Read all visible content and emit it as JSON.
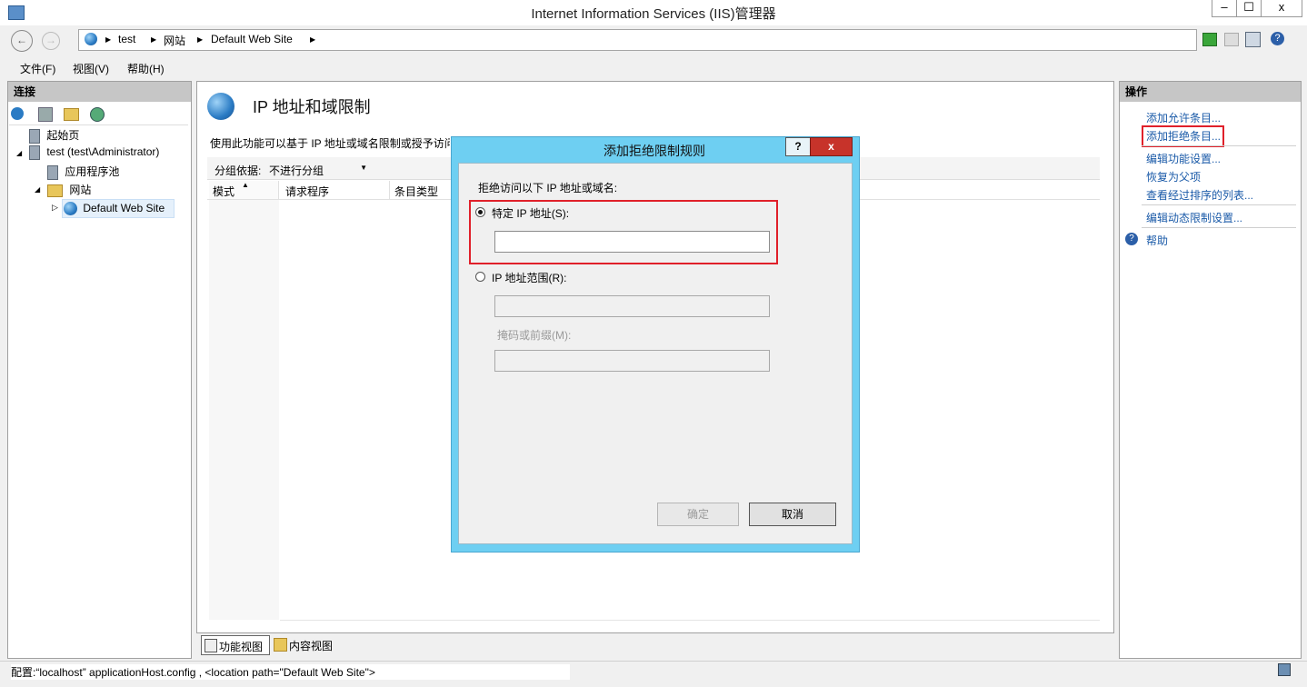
{
  "window": {
    "title": "Internet Information Services (IIS)管理器",
    "min": "–",
    "max": "☐",
    "close": "x"
  },
  "address": {
    "crumbs": [
      "test",
      "网站",
      "Default Web Site"
    ]
  },
  "menu": {
    "file": "文件(F)",
    "view": "视图(V)",
    "help": "帮助(H)"
  },
  "left": {
    "title": "连接",
    "tree": {
      "start": "起始页",
      "server": "test (test\\Administrator)",
      "apppools": "应用程序池",
      "sites": "网站",
      "site": "Default Web Site"
    }
  },
  "center": {
    "title": "IP 地址和域限制",
    "desc": "使用此功能可以基于 IP 地址或域名限制或授予访问",
    "group_label": "分组依据:",
    "group_value": "不进行分组",
    "columns": [
      "模式",
      "请求程序",
      "条目类型"
    ],
    "tab_feature": "功能视图",
    "tab_content": "内容视图"
  },
  "right": {
    "title": "操作",
    "actions": [
      "添加允许条目...",
      "添加拒绝条目...",
      "编辑功能设置...",
      "恢复为父项",
      "查看经过排序的列表...",
      "编辑动态限制设置..."
    ],
    "help": "帮助"
  },
  "dialog": {
    "title": "添加拒绝限制规则",
    "help_btn": "?",
    "close_btn": "x",
    "prompt": "拒绝访问以下 IP 地址或域名:",
    "specific_ip": "特定 IP 地址(S):",
    "ip_range": "IP 地址范围(R):",
    "mask": "掩码或前缀(M):",
    "ok": "确定",
    "cancel": "取消"
  },
  "status": {
    "text": "配置:“localhost” applicationHost.config , <location path=\"Default Web Site\">"
  }
}
